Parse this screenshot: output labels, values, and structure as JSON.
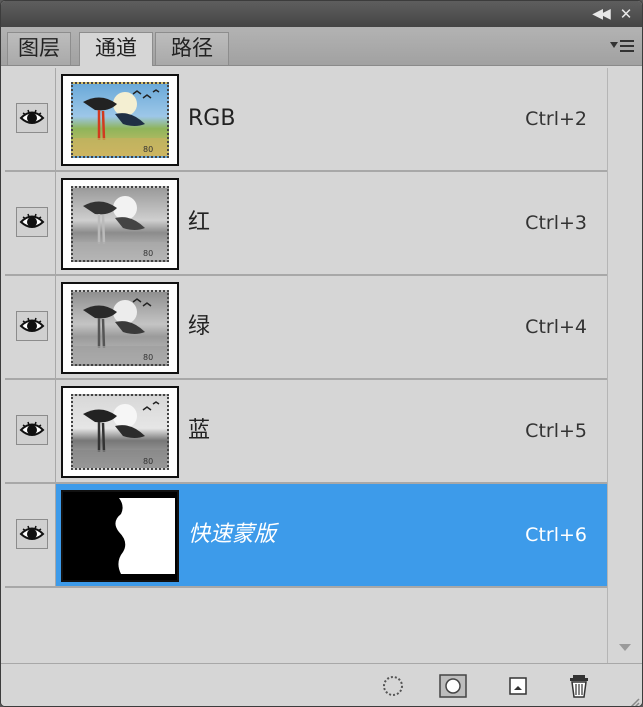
{
  "titlebar": {
    "collapse_icon": "double-chevron-left-icon",
    "close_icon": "close-icon"
  },
  "tabs": [
    {
      "label": "图层",
      "active": false
    },
    {
      "label": "通道",
      "active": true
    },
    {
      "label": "路径",
      "active": false
    }
  ],
  "panel_menu_icon": "panel-menu-icon",
  "channels": [
    {
      "label": "RGB",
      "shortcut": "Ctrl+2",
      "selected": false
    },
    {
      "label": "红",
      "shortcut": "Ctrl+3",
      "selected": false
    },
    {
      "label": "绿",
      "shortcut": "Ctrl+4",
      "selected": false
    },
    {
      "label": "蓝",
      "shortcut": "Ctrl+5",
      "selected": false
    },
    {
      "label": "快速蒙版",
      "shortcut": "Ctrl+6",
      "selected": true
    }
  ],
  "colors": {
    "selection": "#3d9bea",
    "panel_bg": "#d6d6d6"
  }
}
